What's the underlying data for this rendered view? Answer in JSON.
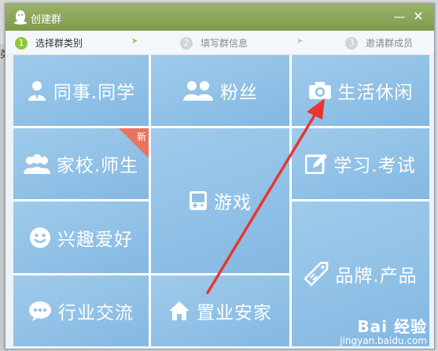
{
  "window": {
    "title": "创建群",
    "controls": {
      "minimize": "—",
      "close": "✕"
    }
  },
  "steps": [
    {
      "num": "1",
      "label": "选择群类别",
      "active": true
    },
    {
      "num": "2",
      "label": "填写群信息",
      "active": false
    },
    {
      "num": "3",
      "label": "邀请群成员",
      "active": false
    }
  ],
  "step_arrows": [
    "➤",
    "➤"
  ],
  "tiles": {
    "colleagues": {
      "label": "同事.同学",
      "icon": "person-icon"
    },
    "fans": {
      "label": "粉丝",
      "icon": "people-icon"
    },
    "life": {
      "label": "生活休闲",
      "icon": "camera-icon"
    },
    "school": {
      "label": "家校.师生",
      "icon": "group-icon",
      "badge": "新"
    },
    "games": {
      "label": "游戏",
      "icon": "gamepad-icon"
    },
    "study": {
      "label": "学习.考试",
      "icon": "edit-icon"
    },
    "hobby": {
      "label": "兴趣爱好",
      "icon": "smile-icon"
    },
    "brand": {
      "label": "品牌.产品",
      "icon": "tag-icon"
    },
    "industry": {
      "label": "行业交流",
      "icon": "chat-icon"
    },
    "realestate": {
      "label": "置业安家",
      "icon": "home-icon"
    }
  },
  "background": {
    "partial_text": "类"
  },
  "colors": {
    "titlebar": "#8aa456",
    "tile": "#8fc0e6",
    "step_active": "#8ec63f",
    "annotation_arrow": "#e8362f",
    "badge": "#e8735e"
  },
  "watermark": {
    "logo": "Bai  经验",
    "url": "jingyan.baidu.com"
  }
}
